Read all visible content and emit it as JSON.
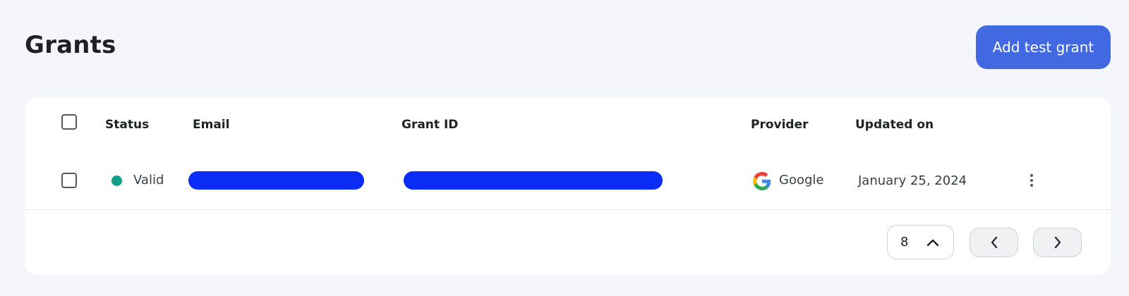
{
  "header": {
    "title": "Grants",
    "add_button_label": "Add test grant"
  },
  "table": {
    "columns": [
      "Status",
      "Email",
      "Grant ID",
      "Provider",
      "Updated on"
    ],
    "rows": [
      {
        "status": "Valid",
        "status_color": "#13a08a",
        "email": "",
        "email_redacted": true,
        "grant_id": "",
        "grant_id_redacted": true,
        "provider": "Google",
        "provider_icon": "google-icon",
        "updated_on": "January 25, 2024"
      }
    ]
  },
  "pagination": {
    "page_size": "8",
    "prev_icon": "chevron-left-icon",
    "next_icon": "chevron-right-icon"
  },
  "colors": {
    "accent": "#4169e1",
    "redaction": "#0a2cf5",
    "valid": "#13a08a"
  }
}
